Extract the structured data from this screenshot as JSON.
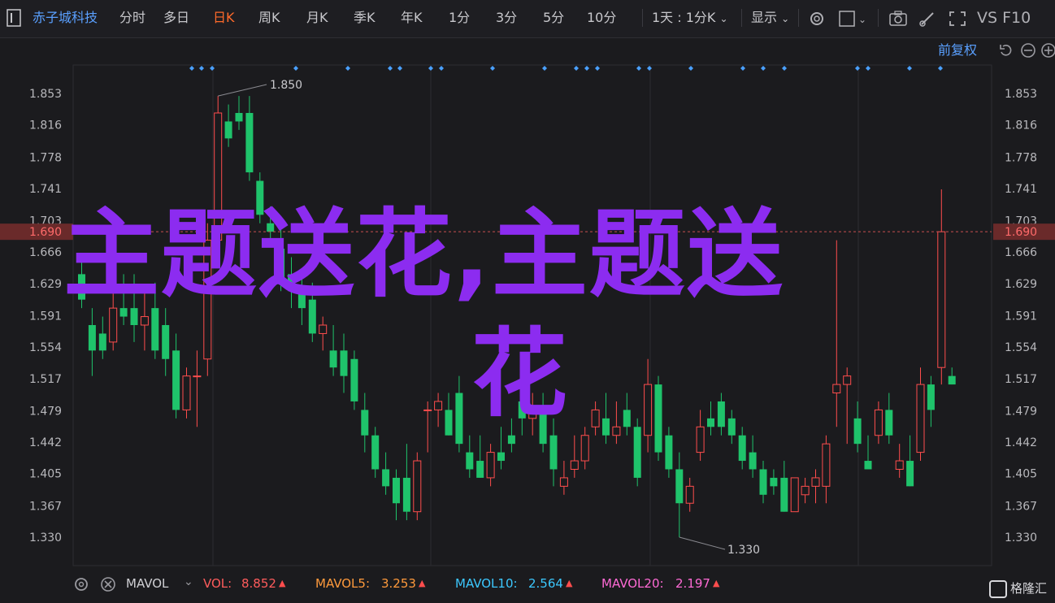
{
  "toolbar": {
    "stock_name": "赤子城科技",
    "periods": [
      "分时",
      "多日",
      "日K",
      "周K",
      "月K",
      "季K",
      "年K",
      "1分",
      "3分",
      "5分",
      "10分"
    ],
    "active_period": "日K",
    "range_select": "1天 : 1分K",
    "display_select": "显示",
    "vs_label": "VS F10"
  },
  "chart_header": {
    "adjust_label": "前复权"
  },
  "price_axis": {
    "ticks": [
      "1.853",
      "1.816",
      "1.778",
      "1.741",
      "1.703",
      "1.666",
      "1.629",
      "1.591",
      "1.554",
      "1.517",
      "1.479",
      "1.442",
      "1.405",
      "1.367",
      "1.330"
    ],
    "current_price": "1.690",
    "high_label": "1.850",
    "low_label": "1.330"
  },
  "indicator_bar": {
    "name": "MAVOL",
    "items": [
      {
        "label": "VOL:",
        "value": "8.852",
        "color": "#ff5c5c"
      },
      {
        "label": "MAVOL5:",
        "value": "3.253",
        "color": "#ff9a3c"
      },
      {
        "label": "MAVOL10:",
        "value": "2.564",
        "color": "#3cc8ff"
      },
      {
        "label": "MAVOL20:",
        "value": "2.197",
        "color": "#ff6ad5"
      }
    ]
  },
  "watermark": {
    "line1": "主题送花,主题送",
    "line2": "花"
  },
  "logo": {
    "text": "格隆汇"
  },
  "colors": {
    "up": "#ff4d4d",
    "down": "#1fc36b",
    "accent": "#ff6a2a",
    "overlay": "#8c2cf0",
    "diamond": "#4aa0ff"
  },
  "chart_data": {
    "type": "candlestick",
    "ylim": [
      1.31,
      1.87
    ],
    "ticks": [
      1.853,
      1.816,
      1.778,
      1.741,
      1.703,
      1.666,
      1.629,
      1.591,
      1.554,
      1.517,
      1.479,
      1.442,
      1.405,
      1.367,
      1.33
    ],
    "current": 1.69,
    "candles": [
      {
        "o": 1.64,
        "h": 1.66,
        "l": 1.6,
        "c": 1.61
      },
      {
        "o": 1.58,
        "h": 1.6,
        "l": 1.52,
        "c": 1.55
      },
      {
        "o": 1.57,
        "h": 1.59,
        "l": 1.54,
        "c": 1.55
      },
      {
        "o": 1.56,
        "h": 1.62,
        "l": 1.55,
        "c": 1.6
      },
      {
        "o": 1.6,
        "h": 1.64,
        "l": 1.58,
        "c": 1.59
      },
      {
        "o": 1.6,
        "h": 1.64,
        "l": 1.56,
        "c": 1.58
      },
      {
        "o": 1.58,
        "h": 1.62,
        "l": 1.55,
        "c": 1.59
      },
      {
        "o": 1.6,
        "h": 1.63,
        "l": 1.54,
        "c": 1.55
      },
      {
        "o": 1.58,
        "h": 1.6,
        "l": 1.52,
        "c": 1.54
      },
      {
        "o": 1.55,
        "h": 1.57,
        "l": 1.47,
        "c": 1.48
      },
      {
        "o": 1.48,
        "h": 1.53,
        "l": 1.47,
        "c": 1.52
      },
      {
        "o": 1.52,
        "h": 1.55,
        "l": 1.46,
        "c": 1.52
      },
      {
        "o": 1.54,
        "h": 1.7,
        "l": 1.52,
        "c": 1.68
      },
      {
        "o": 1.68,
        "h": 1.85,
        "l": 1.66,
        "c": 1.83
      },
      {
        "o": 1.82,
        "h": 1.84,
        "l": 1.79,
        "c": 1.8
      },
      {
        "o": 1.83,
        "h": 1.85,
        "l": 1.81,
        "c": 1.82
      },
      {
        "o": 1.83,
        "h": 1.85,
        "l": 1.75,
        "c": 1.76
      },
      {
        "o": 1.75,
        "h": 1.76,
        "l": 1.7,
        "c": 1.71
      },
      {
        "o": 1.7,
        "h": 1.72,
        "l": 1.68,
        "c": 1.69
      },
      {
        "o": 1.67,
        "h": 1.7,
        "l": 1.62,
        "c": 1.63
      },
      {
        "o": 1.64,
        "h": 1.66,
        "l": 1.6,
        "c": 1.62
      },
      {
        "o": 1.62,
        "h": 1.64,
        "l": 1.58,
        "c": 1.6
      },
      {
        "o": 1.61,
        "h": 1.63,
        "l": 1.56,
        "c": 1.57
      },
      {
        "o": 1.57,
        "h": 1.59,
        "l": 1.55,
        "c": 1.58
      },
      {
        "o": 1.55,
        "h": 1.58,
        "l": 1.52,
        "c": 1.53
      },
      {
        "o": 1.55,
        "h": 1.57,
        "l": 1.5,
        "c": 1.52
      },
      {
        "o": 1.54,
        "h": 1.55,
        "l": 1.48,
        "c": 1.49
      },
      {
        "o": 1.48,
        "h": 1.5,
        "l": 1.43,
        "c": 1.45
      },
      {
        "o": 1.45,
        "h": 1.46,
        "l": 1.4,
        "c": 1.41
      },
      {
        "o": 1.41,
        "h": 1.43,
        "l": 1.38,
        "c": 1.39
      },
      {
        "o": 1.4,
        "h": 1.41,
        "l": 1.35,
        "c": 1.37
      },
      {
        "o": 1.4,
        "h": 1.44,
        "l": 1.35,
        "c": 1.36
      },
      {
        "o": 1.36,
        "h": 1.43,
        "l": 1.35,
        "c": 1.42
      },
      {
        "o": 1.48,
        "h": 1.49,
        "l": 1.43,
        "c": 1.48
      },
      {
        "o": 1.48,
        "h": 1.5,
        "l": 1.46,
        "c": 1.49
      },
      {
        "o": 1.48,
        "h": 1.5,
        "l": 1.45,
        "c": 1.45
      },
      {
        "o": 1.5,
        "h": 1.52,
        "l": 1.43,
        "c": 1.44
      },
      {
        "o": 1.43,
        "h": 1.45,
        "l": 1.4,
        "c": 1.41
      },
      {
        "o": 1.42,
        "h": 1.45,
        "l": 1.4,
        "c": 1.4
      },
      {
        "o": 1.4,
        "h": 1.44,
        "l": 1.39,
        "c": 1.43
      },
      {
        "o": 1.43,
        "h": 1.46,
        "l": 1.41,
        "c": 1.42
      },
      {
        "o": 1.45,
        "h": 1.47,
        "l": 1.43,
        "c": 1.44
      },
      {
        "o": 1.49,
        "h": 1.52,
        "l": 1.45,
        "c": 1.47
      },
      {
        "o": 1.47,
        "h": 1.5,
        "l": 1.45,
        "c": 1.48
      },
      {
        "o": 1.48,
        "h": 1.5,
        "l": 1.43,
        "c": 1.44
      },
      {
        "o": 1.45,
        "h": 1.47,
        "l": 1.39,
        "c": 1.41
      },
      {
        "o": 1.39,
        "h": 1.42,
        "l": 1.38,
        "c": 1.4
      },
      {
        "o": 1.41,
        "h": 1.45,
        "l": 1.4,
        "c": 1.42
      },
      {
        "o": 1.42,
        "h": 1.46,
        "l": 1.41,
        "c": 1.45
      },
      {
        "o": 1.46,
        "h": 1.49,
        "l": 1.45,
        "c": 1.48
      },
      {
        "o": 1.47,
        "h": 1.5,
        "l": 1.44,
        "c": 1.45
      },
      {
        "o": 1.45,
        "h": 1.49,
        "l": 1.44,
        "c": 1.46
      },
      {
        "o": 1.48,
        "h": 1.5,
        "l": 1.45,
        "c": 1.46
      },
      {
        "o": 1.46,
        "h": 1.47,
        "l": 1.39,
        "c": 1.4
      },
      {
        "o": 1.45,
        "h": 1.54,
        "l": 1.43,
        "c": 1.51
      },
      {
        "o": 1.51,
        "h": 1.52,
        "l": 1.42,
        "c": 1.43
      },
      {
        "o": 1.45,
        "h": 1.46,
        "l": 1.4,
        "c": 1.41
      },
      {
        "o": 1.41,
        "h": 1.43,
        "l": 1.33,
        "c": 1.37
      },
      {
        "o": 1.37,
        "h": 1.4,
        "l": 1.36,
        "c": 1.39
      },
      {
        "o": 1.43,
        "h": 1.48,
        "l": 1.42,
        "c": 1.46
      },
      {
        "o": 1.47,
        "h": 1.49,
        "l": 1.45,
        "c": 1.46
      },
      {
        "o": 1.49,
        "h": 1.5,
        "l": 1.45,
        "c": 1.46
      },
      {
        "o": 1.47,
        "h": 1.48,
        "l": 1.44,
        "c": 1.45
      },
      {
        "o": 1.45,
        "h": 1.46,
        "l": 1.41,
        "c": 1.42
      },
      {
        "o": 1.43,
        "h": 1.45,
        "l": 1.4,
        "c": 1.41
      },
      {
        "o": 1.41,
        "h": 1.42,
        "l": 1.37,
        "c": 1.38
      },
      {
        "o": 1.4,
        "h": 1.41,
        "l": 1.38,
        "c": 1.39
      },
      {
        "o": 1.4,
        "h": 1.42,
        "l": 1.36,
        "c": 1.36
      },
      {
        "o": 1.36,
        "h": 1.4,
        "l": 1.36,
        "c": 1.4
      },
      {
        "o": 1.38,
        "h": 1.4,
        "l": 1.37,
        "c": 1.39
      },
      {
        "o": 1.39,
        "h": 1.41,
        "l": 1.37,
        "c": 1.4
      },
      {
        "o": 1.39,
        "h": 1.45,
        "l": 1.37,
        "c": 1.44
      },
      {
        "o": 1.5,
        "h": 1.68,
        "l": 1.46,
        "c": 1.51
      },
      {
        "o": 1.51,
        "h": 1.53,
        "l": 1.44,
        "c": 1.52
      },
      {
        "o": 1.47,
        "h": 1.49,
        "l": 1.43,
        "c": 1.44
      },
      {
        "o": 1.42,
        "h": 1.45,
        "l": 1.41,
        "c": 1.41
      },
      {
        "o": 1.45,
        "h": 1.49,
        "l": 1.44,
        "c": 1.48
      },
      {
        "o": 1.48,
        "h": 1.5,
        "l": 1.44,
        "c": 1.45
      },
      {
        "o": 1.41,
        "h": 1.44,
        "l": 1.4,
        "c": 1.42
      },
      {
        "o": 1.42,
        "h": 1.45,
        "l": 1.39,
        "c": 1.39
      },
      {
        "o": 1.43,
        "h": 1.53,
        "l": 1.42,
        "c": 1.51
      },
      {
        "o": 1.51,
        "h": 1.52,
        "l": 1.46,
        "c": 1.48
      },
      {
        "o": 1.53,
        "h": 1.74,
        "l": 1.51,
        "c": 1.69
      },
      {
        "o": 1.52,
        "h": 1.53,
        "l": 1.51,
        "c": 1.51
      }
    ]
  }
}
